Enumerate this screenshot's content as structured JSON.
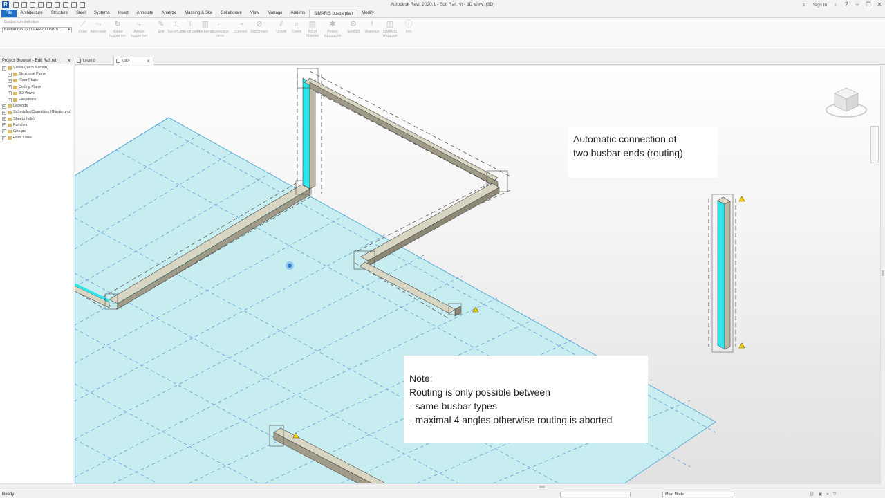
{
  "window": {
    "title": "Autodesk Revit 2020.1 - Edit Rail.rvt - 3D View: {3D}",
    "signin": "Sign In"
  },
  "ribbon_tabs": [
    "File",
    "Architecture",
    "Structure",
    "Steel",
    "Systems",
    "Insert",
    "Annotate",
    "Analyze",
    "Massing & Site",
    "Collaborate",
    "View",
    "Manage",
    "Add-Ins",
    "SIMARIS busbarplan",
    "Modify"
  ],
  "active_tab": "SIMARIS busbarplan",
  "ribbon": {
    "definition_label": "Busbar run definition",
    "run_select": "Busbar run 01 | LI-AM20005B-S...",
    "buttons": [
      {
        "label": "Draw",
        "icon": "draw-icon"
      },
      {
        "label": "Auto-route",
        "icon": "auto-route-icon"
      },
      {
        "label": "Rotate busbar run",
        "icon": "rotate-icon"
      },
      {
        "label": "Assign busbar run",
        "icon": "assign-icon"
      },
      {
        "label": "Edit",
        "icon": "edit-icon"
      },
      {
        "label": "Tap-off unit",
        "icon": "tap-off-unit-icon"
      },
      {
        "label": "Tap-off point",
        "icon": "tap-off-point-icon"
      },
      {
        "label": "Fire barrier",
        "icon": "fire-barrier-icon"
      },
      {
        "label": "Connection piece",
        "icon": "connection-piece-icon"
      },
      {
        "label": "Connect",
        "icon": "connect-icon"
      },
      {
        "label": "Disconnect",
        "icon": "disconnect-icon"
      },
      {
        "label": "Unsplit",
        "icon": "unsplit-icon"
      },
      {
        "label": "Check",
        "icon": "check-icon"
      },
      {
        "label": "Bill of Material",
        "icon": "bill-of-material-icon"
      },
      {
        "label": "Project Information",
        "icon": "project-info-icon"
      },
      {
        "label": "Settings",
        "icon": "settings-icon"
      },
      {
        "label": "Warnings",
        "icon": "warnings-icon"
      },
      {
        "label": "SIMARIS Webpage",
        "icon": "webpage-icon"
      },
      {
        "label": "Info",
        "icon": "info-icon"
      }
    ]
  },
  "project_browser": {
    "title": "Project Browser - Edit Rail.rvt",
    "items": [
      {
        "label": "Views (nach Namen)",
        "level": 0
      },
      {
        "label": "Structural Plans",
        "level": 1
      },
      {
        "label": "Floor Plans",
        "level": 1
      },
      {
        "label": "Ceiling Plans",
        "level": 1
      },
      {
        "label": "3D Views",
        "level": 1
      },
      {
        "label": "Elevations",
        "level": 1
      },
      {
        "label": "Legends",
        "level": 0
      },
      {
        "label": "Schedules/Quantities (Gliederung)",
        "level": 0
      },
      {
        "label": "Sheets (alle)",
        "level": 0
      },
      {
        "label": "Families",
        "level": 0
      },
      {
        "label": "Groups",
        "level": 0
      },
      {
        "label": "Revit Links",
        "level": 0
      }
    ]
  },
  "view_tabs": [
    {
      "label": "Level 0",
      "active": false
    },
    {
      "label": "{3D}",
      "active": true
    }
  ],
  "callouts": {
    "automatic": [
      "Automatic connection of",
      "two busbar ends (routing)"
    ],
    "note": [
      "Note:",
      "Routing is only possible between",
      "- same busbar types",
      "- maximal 4 angles otherwise routing is aborted"
    ]
  },
  "status": {
    "ready": "Ready",
    "model": "Main Model"
  },
  "colors": {
    "floor": "#c6ecef",
    "grid_dash": "#4a90d9",
    "busbar_core": "#2de7ea",
    "busbar_body": "#d8d4c4",
    "accent_tab": "#1e6fc5"
  }
}
